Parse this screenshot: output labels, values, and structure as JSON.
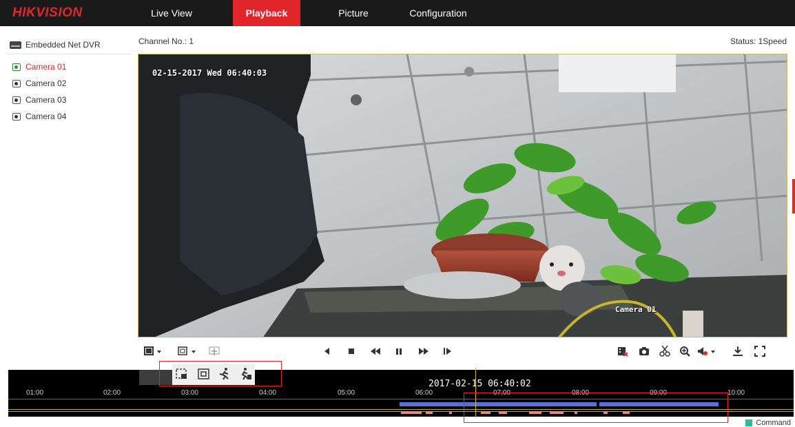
{
  "app": {
    "logo": "HIKVISION",
    "nav": [
      "Live View",
      "Playback",
      "Picture",
      "Configuration"
    ],
    "active_nav": "Playback",
    "accent_color": "#e0262b"
  },
  "sidebar": {
    "device": "Embedded Net DVR",
    "cameras": [
      {
        "label": "Camera 01",
        "active": true
      },
      {
        "label": "Camera 02",
        "active": false
      },
      {
        "label": "Camera 03",
        "active": false
      },
      {
        "label": "Camera 04",
        "active": false
      }
    ]
  },
  "header": {
    "channel": "Channel No.: 1",
    "status": "Status: 1Speed"
  },
  "video": {
    "osd_time": "02-15-2017 Wed 06:40:03",
    "osd_camera": "Camera 01"
  },
  "controls": {
    "left": [
      "layout-icon",
      "window-select-icon",
      "smart-search-icon"
    ],
    "center": [
      "reverse-play-icon",
      "stop-icon",
      "slow-forward-icon",
      "pause-icon",
      "fast-forward-icon",
      "single-frame-icon"
    ],
    "right": [
      "clip-video-icon",
      "capture-icon",
      "cut-icon",
      "digital-zoom-icon",
      "volume-icon",
      "download-icon",
      "fullscreen-icon"
    ],
    "popup": [
      "event-area-icon",
      "region-icon",
      "motion-icon",
      "intrusion-icon"
    ]
  },
  "timeline": {
    "current": "2017-02-15 06:40:02",
    "ticks": [
      "01:00",
      "02:00",
      "03:00",
      "04:00",
      "05:00",
      "06:00",
      "07:00",
      "08:00",
      "09:00",
      "10:00"
    ],
    "legend": "Command",
    "legend_color": "#2fb89a",
    "record_color": "#5b6fd8",
    "event_color": "#e8887a"
  }
}
